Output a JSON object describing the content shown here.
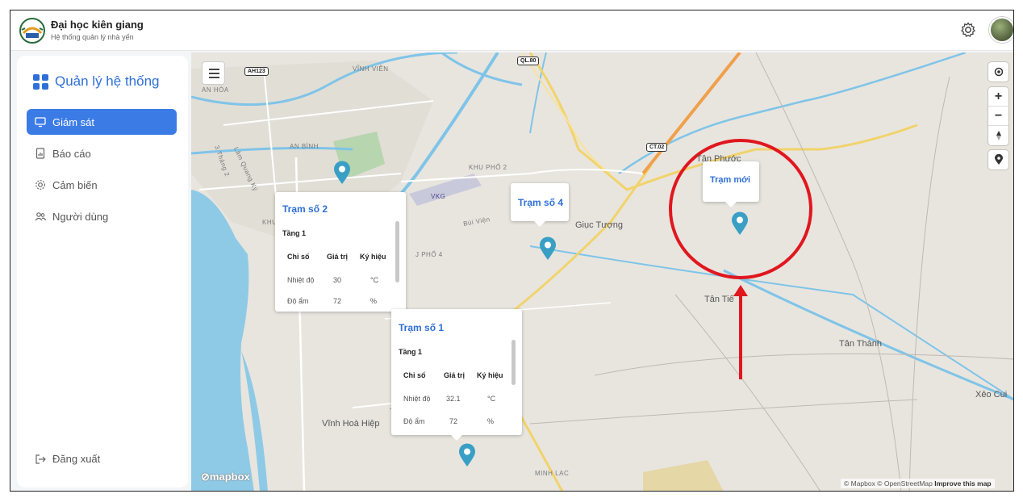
{
  "header": {
    "title": "Đại học kiên giang",
    "subtitle": "Hệ thống quản lý nhà yến"
  },
  "sidebar": {
    "title": "Quản lý hệ thống",
    "items": [
      {
        "label": "Giám sát",
        "icon": "monitor-icon",
        "active": true
      },
      {
        "label": "Báo cáo",
        "icon": "report-icon",
        "active": false
      },
      {
        "label": "Cảm biến",
        "icon": "sensor-icon",
        "active": false
      },
      {
        "label": "Người dùng",
        "icon": "users-icon",
        "active": false
      }
    ],
    "logout": "Đăng xuất"
  },
  "map": {
    "labels": {
      "vinh_vien": "VĨNH VIỄN",
      "an_hoa": "AN HÒA",
      "an_binh": "AN BÌNH",
      "khu_pho_2": "KHU PHỐ 2",
      "khu_p": "KHU P",
      "vkg": "VKG",
      "bui_vien": "Bùi Viện",
      "khu_pho_4": "J PHỐ 4",
      "giuc_tuong": "Giục Tượng",
      "tan_phuoc": "Tân Phước",
      "tan_tien": "Tân Tiế",
      "tan_thanh": "Tân Thành",
      "xeo_cui": "Xẻo Cui",
      "vinh_hoa_hiep": "Vĩnh Hoà Hiệp",
      "minh_lac": "MINH LẠC",
      "street_3thang2": "3 Tháng 2",
      "street_lqk": "Lâm Quang Ký",
      "ta": "Ta"
    },
    "shields": {
      "ah123": "AH123",
      "ql80": "QL.80",
      "ct02": "CT.02"
    },
    "attribution": "© Mapbox © OpenStreetMap",
    "improve": "Improve this map",
    "mapbox": "mapbox",
    "controls": {
      "zoom_in": "+",
      "zoom_out": "−"
    }
  },
  "stations": {
    "s2": {
      "name": "Trạm số 2",
      "floor": "Tầng 1",
      "headers": [
        "Chỉ số",
        "Giá trị",
        "Ký hiệu"
      ],
      "rows": [
        [
          "Nhiệt độ",
          "30",
          "°C"
        ],
        [
          "Độ ẩm",
          "72",
          "%"
        ]
      ]
    },
    "s1": {
      "name": "Trạm số 1",
      "floor": "Tầng 1",
      "headers": [
        "Chỉ số",
        "Giá trị",
        "Ký hiệu"
      ],
      "rows": [
        [
          "Nhiệt độ",
          "32.1",
          "°C"
        ],
        [
          "Độ ẩm",
          "72",
          "%"
        ]
      ]
    },
    "s4": {
      "name": "Trạm số 4"
    },
    "new": {
      "name": "Trạm mới"
    }
  },
  "colors": {
    "accent": "#3b7be6",
    "pin": "#3a9fc4",
    "annotation": "#e0171f"
  }
}
